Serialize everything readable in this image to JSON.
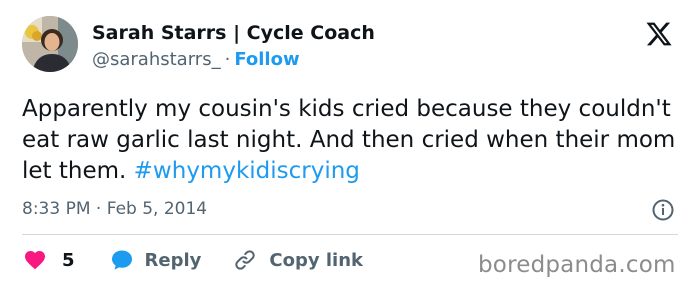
{
  "author": {
    "display_name": "Sarah Starrs | Cycle Coach",
    "handle": "@sarahstarrs_",
    "separator": "·",
    "follow_label": "Follow"
  },
  "tweet": {
    "text": "Apparently my cousin's kids cried because they couldn't eat raw garlic last night. And then cried when their mom let them.",
    "hashtag": "#whymykidiscrying",
    "time": "8:33 PM",
    "separator": "·",
    "date": "Feb 5, 2014"
  },
  "actions": {
    "like_count": "5",
    "reply_label": "Reply",
    "copy_link_label": "Copy link"
  },
  "icons": {
    "platform": "x-logo-icon",
    "info": "info-icon",
    "like": "heart-icon",
    "reply": "speech-bubble-icon",
    "copy": "link-icon"
  },
  "colors": {
    "link": "#1d9bf0",
    "heart": "#f91880",
    "text": "#0f1419",
    "muted": "#536471"
  },
  "watermark": "boredpanda.com"
}
